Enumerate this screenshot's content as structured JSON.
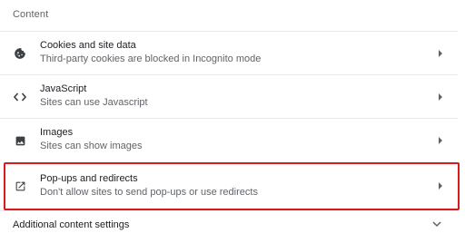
{
  "section": {
    "title": "Content"
  },
  "rows": [
    {
      "label": "Cookies and site data",
      "description": "Third-party cookies are blocked in Incognito mode",
      "icon": "cookie-icon"
    },
    {
      "label": "JavaScript",
      "description": "Sites can use Javascript",
      "icon": "code-icon"
    },
    {
      "label": "Images",
      "description": "Sites can show images",
      "icon": "image-icon"
    },
    {
      "label": "Pop-ups and redirects",
      "description": "Don't allow sites to send pop-ups or use redirects",
      "icon": "open-in-new-icon",
      "highlighted": true
    }
  ],
  "additional": {
    "label": "Additional content settings",
    "icon": "chevron-down-icon"
  },
  "colors": {
    "highlight_border": "#d81b1b",
    "primary_text": "#202124",
    "secondary_text": "#5f6368",
    "icon": "#5f6368",
    "divider": "#e8eaed"
  }
}
